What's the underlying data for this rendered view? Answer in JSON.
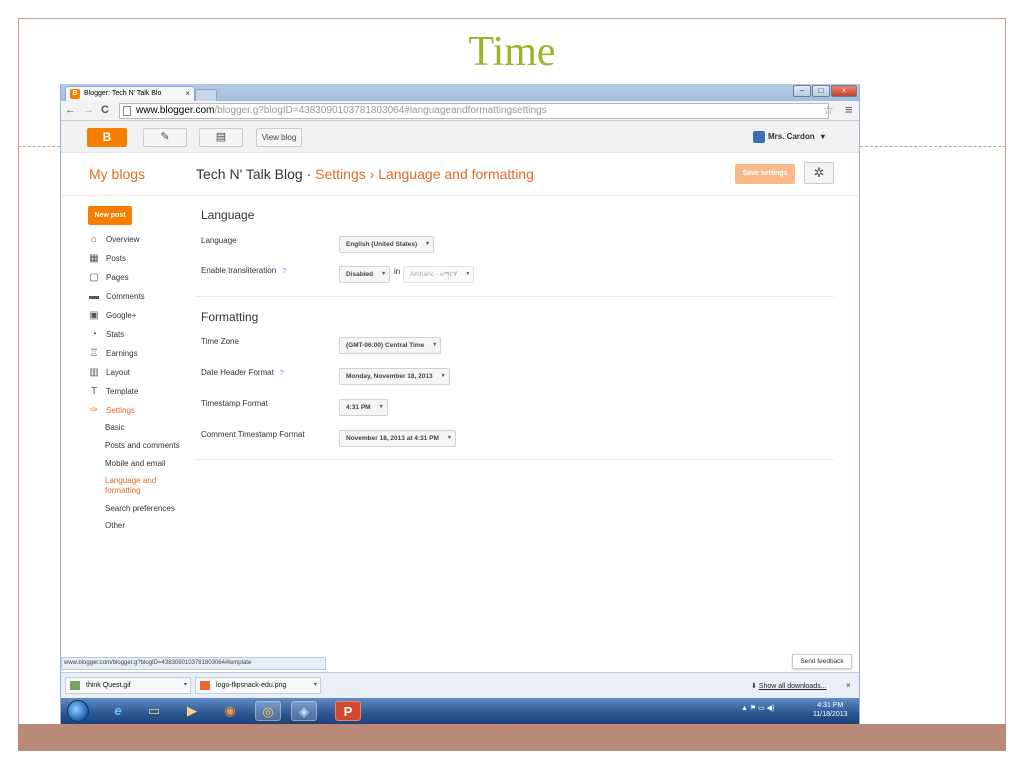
{
  "slide": {
    "title": "Time"
  },
  "browser": {
    "tab_title": "Blogger: Tech N' Talk Blo",
    "tab_close": "×",
    "favicon": "B",
    "url_host": "www.blogger.com",
    "url_path": "/blogger.g?blogID=4383090103781803064#languageandformattingsettings",
    "nav_back": "←",
    "nav_forward": "→",
    "reload": "C",
    "star": "☆",
    "menu": "≡",
    "win_min": "–",
    "win_max": "□",
    "win_close": "×"
  },
  "blogger_header": {
    "logo": "B",
    "pencil": "✎",
    "pages": "▤",
    "view_blog": "View blog",
    "user_name": "Mrs. Cardon",
    "user_caret": "▾"
  },
  "page_header": {
    "my_blogs": "My blogs",
    "blog_name": "Tech N' Talk Blog",
    "separator": "·",
    "settings": "Settings",
    "arrow": "›",
    "current": "Language and formatting",
    "save_button": "Save settings",
    "gear": "✲"
  },
  "sidebar": {
    "new_post": "New post",
    "items": [
      {
        "label": "Overview",
        "icon": "home-icon",
        "glyph": "⌂"
      },
      {
        "label": "Posts",
        "icon": "posts-icon",
        "glyph": "▦"
      },
      {
        "label": "Pages",
        "icon": "pages-icon",
        "glyph": "▢"
      },
      {
        "label": "Comments",
        "icon": "comments-icon",
        "glyph": "▬"
      },
      {
        "label": "Google+",
        "icon": "googleplus-icon",
        "glyph": "▣"
      },
      {
        "label": "Stats",
        "icon": "stats-icon",
        "glyph": "◔"
      },
      {
        "label": "Earnings",
        "icon": "trophy-icon",
        "glyph": "♖"
      },
      {
        "label": "Layout",
        "icon": "layout-icon",
        "glyph": "▥"
      },
      {
        "label": "Template",
        "icon": "template-icon",
        "glyph": "T"
      },
      {
        "label": "Settings",
        "icon": "wrench-icon",
        "glyph": "✑"
      }
    ],
    "subitems": [
      "Basic",
      "Posts and comments",
      "Mobile and email",
      "Language and formatting",
      "Search preferences",
      "Other"
    ]
  },
  "language": {
    "title": "Language",
    "language_label": "Language",
    "language_value": "English (United States)",
    "translit_label": "Enable transliteration",
    "help": "?",
    "translit_value": "Disabled",
    "in_word": "in",
    "translit_lang": "Amharic - አማርኛ"
  },
  "formatting": {
    "title": "Formatting",
    "timezone_label": "Time Zone",
    "timezone_value": "(GMT-06:00) Central Time",
    "date_header_label": "Date Header Format",
    "date_header_value": "Monday, November 18, 2013",
    "timestamp_label": "Timestamp Format",
    "timestamp_value": "4:31 PM",
    "comment_ts_label": "Comment Timestamp Format",
    "comment_ts_value": "November 18, 2013 at 4:31 PM",
    "caret": "▾"
  },
  "status": {
    "url": "www.blogger.com/blogger.g?blogID=4383090103781803064#template",
    "feedback": "Send feedback"
  },
  "downloads": {
    "items": [
      "think Quest.gif",
      "logo-flipsnack-edu.png"
    ],
    "arrow": "▾",
    "show_all": "Show all downloads...",
    "download_glyph": "⬇",
    "close": "×"
  },
  "taskbar": {
    "apps": [
      {
        "name": "ie-icon",
        "glyph": "e"
      },
      {
        "name": "folder-icon",
        "glyph": "▭"
      },
      {
        "name": "media-player-icon",
        "glyph": "▶"
      },
      {
        "name": "firefox-icon",
        "glyph": "◉"
      },
      {
        "name": "chrome-icon",
        "glyph": "◎"
      },
      {
        "name": "app-icon",
        "glyph": "◈"
      },
      {
        "name": "powerpoint-icon",
        "glyph": "P"
      }
    ],
    "tray": "▲ ⚑ ▭ ◀)",
    "time": "4:31 PM",
    "date": "11/18/2013"
  }
}
